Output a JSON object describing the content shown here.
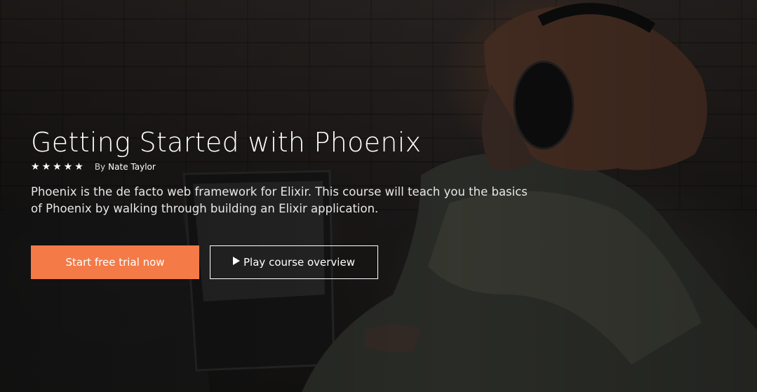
{
  "course": {
    "title": "Getting Started with Phoenix",
    "rating": 5,
    "author_prefix": "By",
    "author_name": "Nate Taylor",
    "description": "Phoenix is the de facto web framework for Elixir. This course will teach you the basics of Phoenix by walking through building an Elixir application."
  },
  "actions": {
    "primary_label": "Start free trial now",
    "secondary_label": "Play course overview"
  },
  "colors": {
    "accent": "#f47a47",
    "text": "#ffffff"
  },
  "icons": {
    "star": "star-icon",
    "play": "play-icon"
  }
}
